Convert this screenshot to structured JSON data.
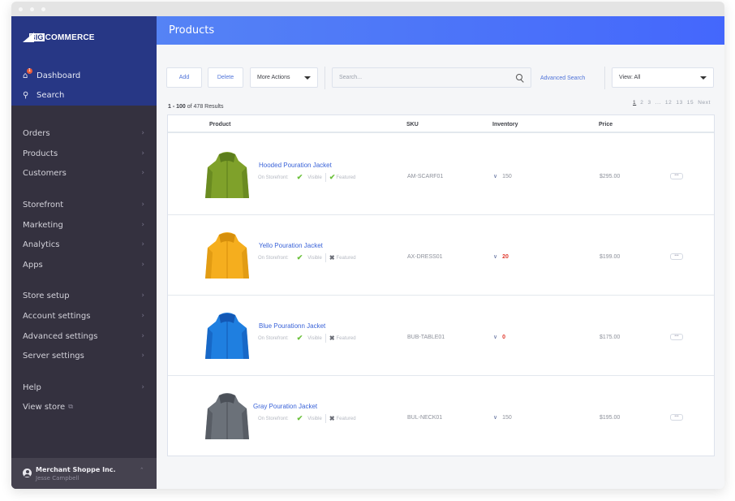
{
  "window": {
    "title_dots": 3
  },
  "sidebar": {
    "logo": {
      "big": "BIG",
      "rest": "COMMERCE"
    },
    "top_items": [
      {
        "label": "Dashboard",
        "icon": "home-icon",
        "badge": "1"
      },
      {
        "label": "Search",
        "icon": "search-icon"
      }
    ],
    "groups": [
      [
        {
          "label": "Orders"
        },
        {
          "label": "Products"
        },
        {
          "label": "Customers"
        }
      ],
      [
        {
          "label": "Storefront"
        },
        {
          "label": "Marketing"
        },
        {
          "label": "Analytics"
        },
        {
          "label": "Apps"
        }
      ],
      [
        {
          "label": "Store setup"
        },
        {
          "label": "Account settings"
        },
        {
          "label": "Advanced settings"
        },
        {
          "label": "Server settings"
        }
      ],
      [
        {
          "label": "Help"
        },
        {
          "label": "View store",
          "external": true
        }
      ]
    ],
    "account": {
      "store": "Merchant Shoppe Inc.",
      "user": "Jesse Campbell"
    }
  },
  "header": {
    "title": "Products"
  },
  "toolbar": {
    "add_label": "Add",
    "delete_label": "Delete",
    "more_actions_label": "More Actions",
    "search_placeholder": "Search...",
    "advanced_search_label": "Advanced Search",
    "view_label": "View: All"
  },
  "results": {
    "range": "1 - 100",
    "rest": "of 478 Results"
  },
  "pagination": {
    "pages": [
      "1",
      "2",
      "3",
      "...",
      "12",
      "13",
      "15"
    ],
    "current": "1",
    "next_label": "Next"
  },
  "table": {
    "columns": {
      "product": "Product",
      "sku": "SKU",
      "inventory": "Inventory",
      "price": "Price"
    },
    "storefront_label": "On Storefront:",
    "visible_label": "Visible",
    "featured_label": "Featured",
    "rows": [
      {
        "name": "Hooded Pouration Jacket",
        "sku": "AM-SCARF01",
        "inventory": "150",
        "low": false,
        "price": "$295.00",
        "visible": true,
        "featured": true,
        "color": "#7fa12a",
        "dark": "#5c7d1c"
      },
      {
        "name": "Yello Pouration Jacket",
        "sku": "AX-DRESS01",
        "inventory": "20",
        "low": true,
        "price": "$199.00",
        "visible": true,
        "featured": false,
        "color": "#f5ae1e",
        "dark": "#d68f0c"
      },
      {
        "name": "Blue Pourationn Jacket",
        "sku": "BUB-TABLE01",
        "inventory": "0",
        "low": true,
        "price": "$175.00",
        "visible": true,
        "featured": false,
        "color": "#1f7fe0",
        "dark": "#1358b5"
      },
      {
        "name": "Gray Pouration Jacket",
        "sku": "BUL-NECK01",
        "inventory": "150",
        "low": false,
        "price": "$195.00",
        "visible": true,
        "featured": false,
        "color": "#6b7179",
        "dark": "#4b5058"
      }
    ]
  }
}
